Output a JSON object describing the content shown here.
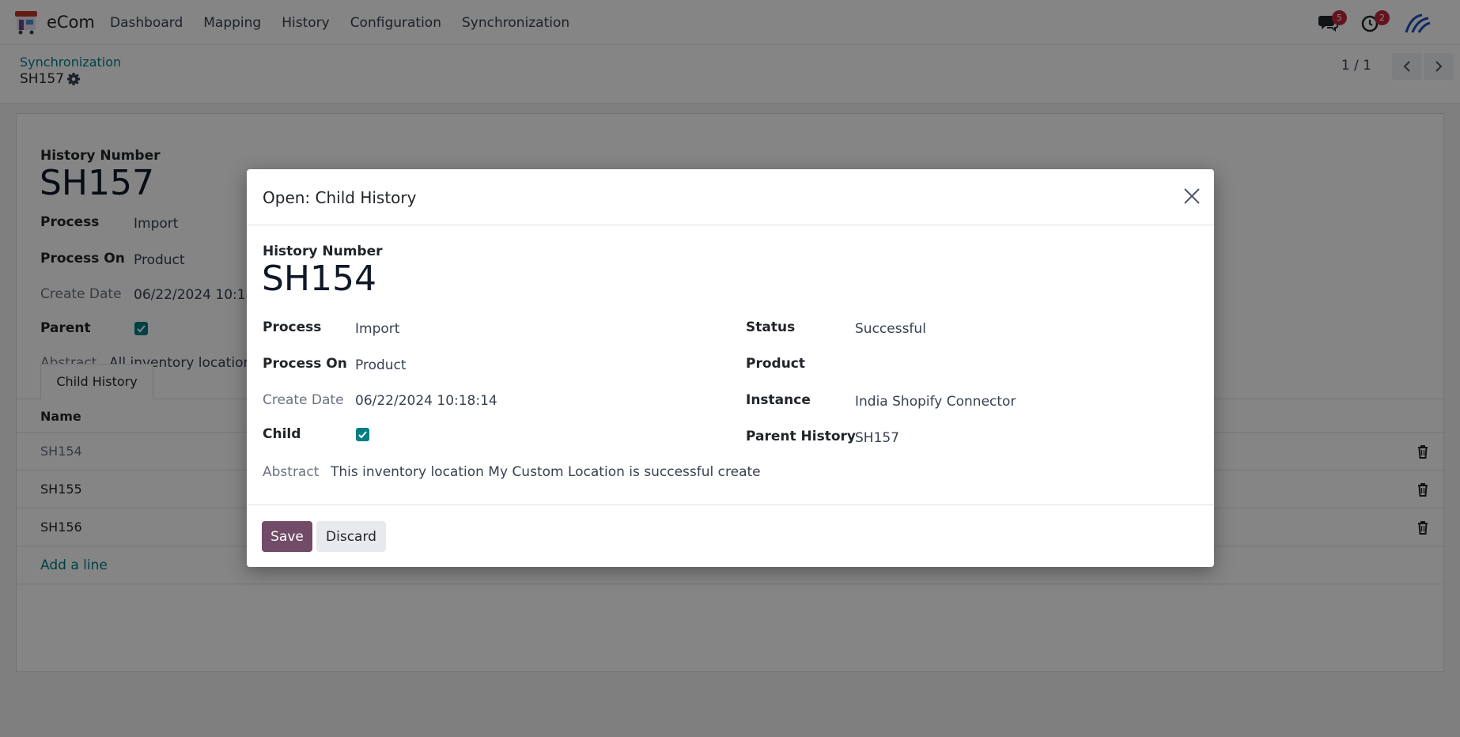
{
  "navbar": {
    "app_name": "eCom",
    "menu": [
      "Dashboard",
      "Mapping",
      "History",
      "Configuration",
      "Synchronization"
    ],
    "messages_badge": "5",
    "activities_badge": "2"
  },
  "control_panel": {
    "breadcrumb_parent": "Synchronization",
    "breadcrumb_current": "SH157",
    "pager": "1 / 1"
  },
  "record": {
    "history_number_label": "History Number",
    "history_number": "SH157",
    "process_label": "Process",
    "process": "Import",
    "process_on_label": "Process On",
    "process_on": "Product",
    "create_date_label": "Create Date",
    "create_date": "06/22/2024 10:18:",
    "parent_label": "Parent",
    "parent_checked": true,
    "abstract_label": "Abstract",
    "abstract": "All inventory location",
    "tab_label": "Child History",
    "list": {
      "column_name": "Name",
      "rows": [
        "SH154",
        "SH155",
        "SH156"
      ],
      "add_line": "Add a line"
    }
  },
  "dialog": {
    "title": "Open: Child History",
    "history_number_label": "History Number",
    "history_number": "SH154",
    "process_label": "Process",
    "process": "Import",
    "process_on_label": "Process On",
    "process_on": "Product",
    "create_date_label": "Create Date",
    "create_date": "06/22/2024 10:18:14",
    "child_label": "Child",
    "child_checked": true,
    "status_label": "Status",
    "status": "Successful",
    "product_label": "Product",
    "product": "",
    "instance_label": "Instance",
    "instance": "India Shopify Connector",
    "parent_history_label": "Parent History",
    "parent_history": "SH157",
    "abstract_label": "Abstract",
    "abstract": "This inventory location My Custom Location is successful create",
    "save_label": "Save",
    "discard_label": "Discard"
  },
  "colors": {
    "brand": "#714b67",
    "link": "#017e84",
    "badge": "#c0273b"
  }
}
